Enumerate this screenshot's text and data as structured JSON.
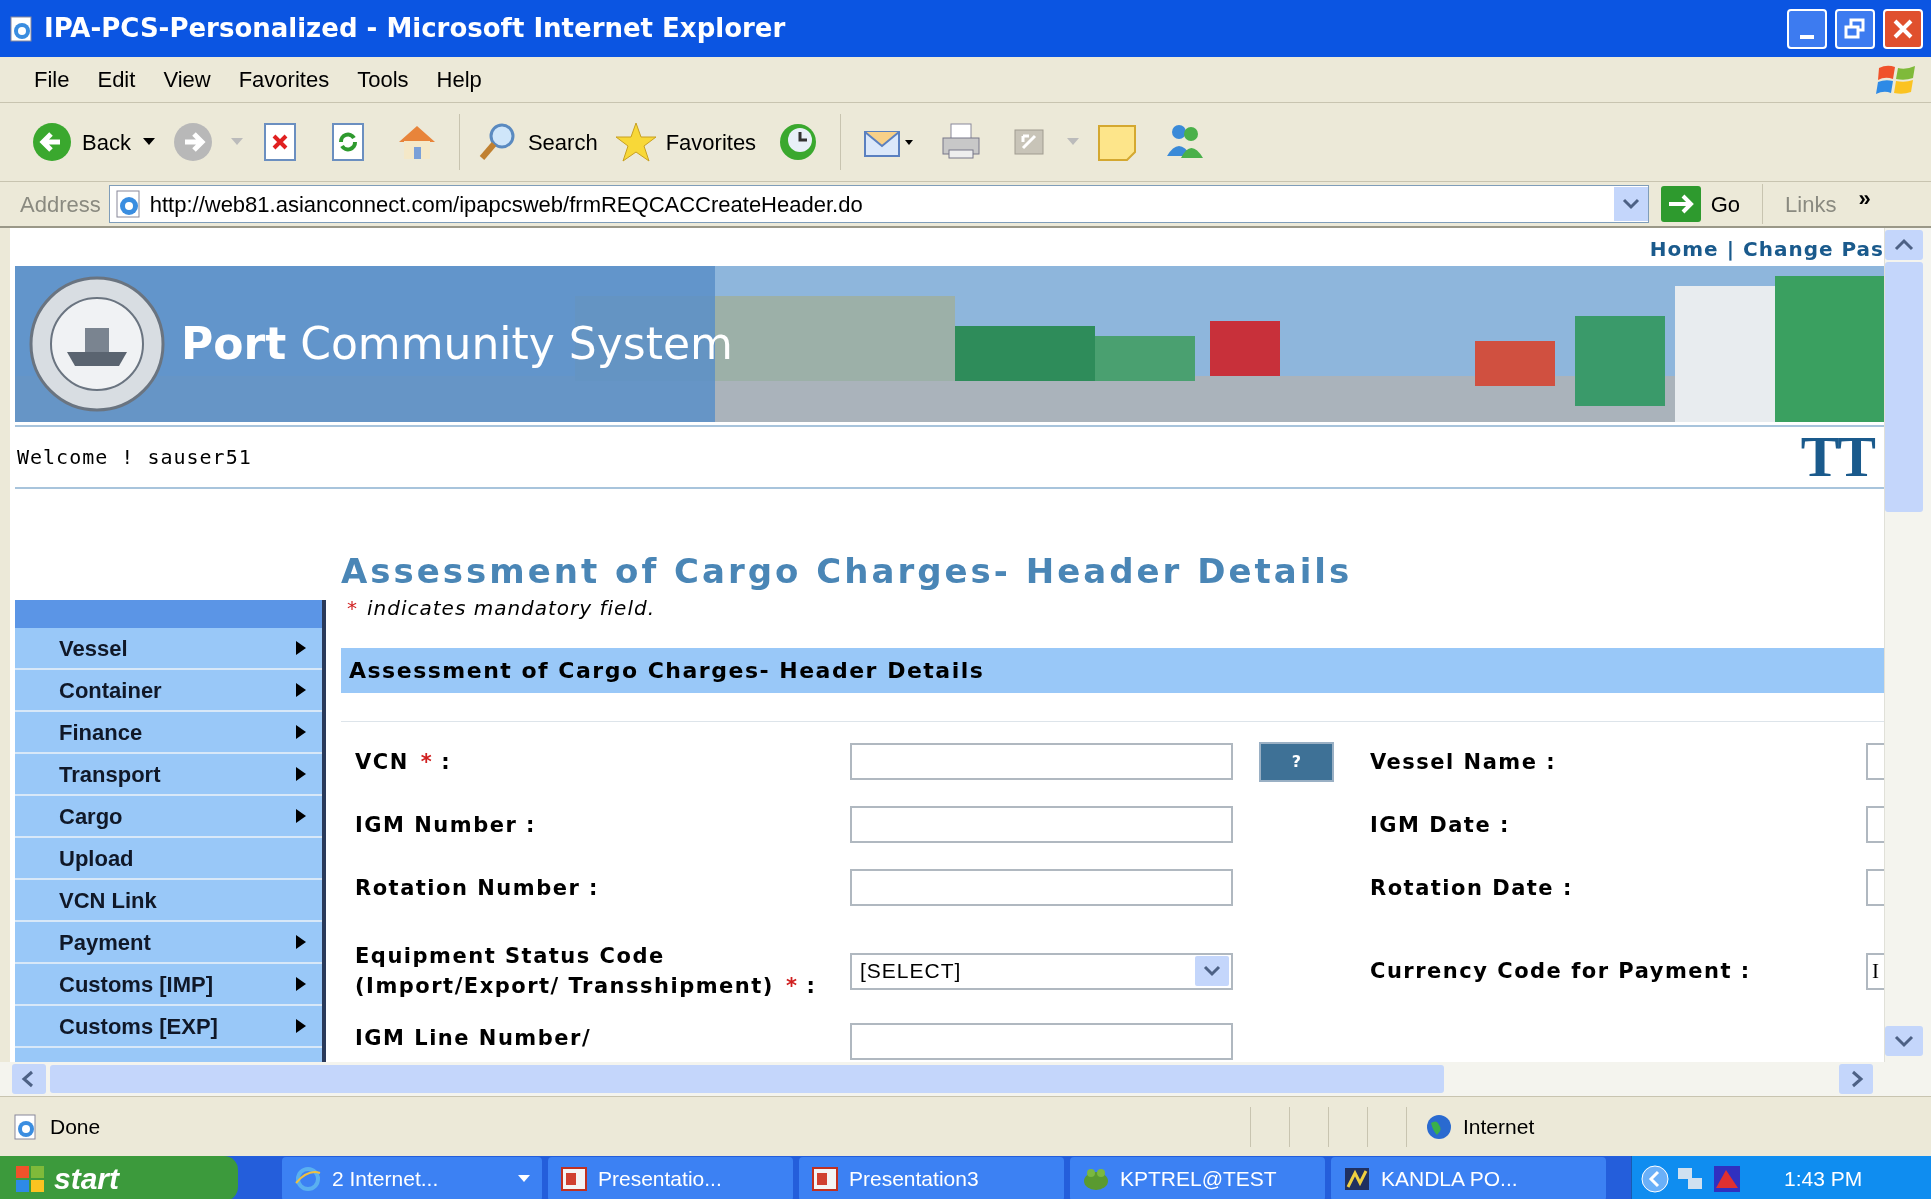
{
  "window": {
    "title": "IPA-PCS-Personalized - Microsoft Internet Explorer"
  },
  "menu": [
    "File",
    "Edit",
    "View",
    "Favorites",
    "Tools",
    "Help"
  ],
  "toolbar": [
    {
      "kind": "back",
      "label": "Back"
    },
    {
      "kind": "forward"
    },
    {
      "kind": "stop"
    },
    {
      "kind": "refresh"
    },
    {
      "kind": "home"
    },
    {
      "kind": "search",
      "label": "Search"
    },
    {
      "kind": "favorites",
      "label": "Favorites"
    },
    {
      "kind": "history"
    },
    {
      "kind": "mail"
    },
    {
      "kind": "print"
    },
    {
      "kind": "edit"
    },
    {
      "kind": "note"
    },
    {
      "kind": "messenger"
    }
  ],
  "address": {
    "label": "Address",
    "value": "http://web81.asianconnect.com/ipapcsweb/frmREQCACCreateHeader.do",
    "go": "Go",
    "links": "Links",
    "more": "»"
  },
  "page": {
    "top_links": {
      "items": [
        "Home",
        "Change Pas"
      ],
      "separator": "|"
    },
    "banner": {
      "title": "**Port** Community System"
    },
    "welcome": "Welcome ! sauser51",
    "corner_logo": "TT",
    "heading": "Assessment of Cargo Charges- Header Details",
    "mandatory_note": {
      "mark": "*",
      "text": "indicates mandatory field."
    },
    "nav": [
      {
        "label": "Vessel",
        "submenu": true
      },
      {
        "label": "Container",
        "submenu": true
      },
      {
        "label": "Finance",
        "submenu": true
      },
      {
        "label": "Transport",
        "submenu": true
      },
      {
        "label": "Cargo",
        "submenu": true
      },
      {
        "label": "Upload",
        "submenu": false
      },
      {
        "label": "VCN Link",
        "submenu": false
      },
      {
        "label": "Payment",
        "submenu": true
      },
      {
        "label": "Customs [IMP]",
        "submenu": true
      },
      {
        "label": "Customs [EXP]",
        "submenu": true
      }
    ],
    "section_title": "Assessment of Cargo Charges- Header Details",
    "rows": [
      {
        "left": {
          "label": "VCN",
          "mark": "*",
          "suffix": ":",
          "kind": "text",
          "button": "?"
        },
        "right": {
          "label": "Vessel Name :",
          "kind": "text"
        }
      },
      {
        "left": {
          "label": "IGM Number :",
          "kind": "text"
        },
        "right": {
          "label": "IGM Date :",
          "kind": "text"
        }
      },
      {
        "left": {
          "label": "Rotation Number :",
          "kind": "text"
        },
        "right": {
          "label": "Rotation Date :",
          "kind": "text"
        }
      },
      {
        "left": {
          "label": "Equipment Status Code (Import/Export/ Transshipment)",
          "mark": "*",
          "suffix": ":",
          "kind": "select",
          "value": "[SELECT]"
        },
        "right": {
          "label": "Currency Code for Payment :",
          "kind": "text",
          "value": "I"
        }
      },
      {
        "left": {
          "label": "IGM Line Number/",
          "kind": "text"
        }
      }
    ]
  },
  "status_bar": {
    "text": "Done",
    "zone": "Internet"
  },
  "taskbar": {
    "start": "start",
    "items": [
      {
        "label": "2 Internet...",
        "kind": "ie",
        "group": true
      },
      {
        "label": "Presentatio...",
        "kind": "ppt",
        "group": false
      },
      {
        "label": "Presentation3",
        "kind": "ppt",
        "group": false
      },
      {
        "label": "KPTREL@TEST",
        "kind": "frog",
        "group": false
      },
      {
        "label": "KANDLA PO...",
        "kind": "app",
        "group": false
      }
    ],
    "clock": "1:43 PM"
  }
}
